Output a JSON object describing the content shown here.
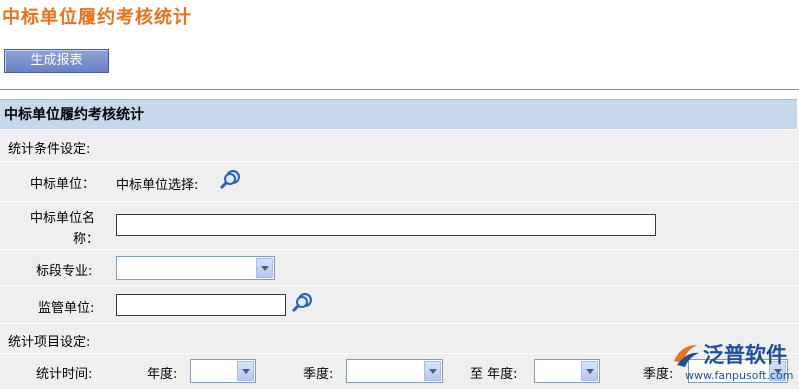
{
  "page": {
    "title": "中标单位履约考核统计"
  },
  "toolbar": {
    "generate_label": "生成报表"
  },
  "panel": {
    "header": "中标单位履约考核统计"
  },
  "conditions": {
    "section_label": "统计条件设定:",
    "winning_unit_label": "中标单位：",
    "winning_unit_select_text": "中标单位选择:",
    "winning_unit_name_label_line1": "中标单位名",
    "winning_unit_name_label_line2": "称：",
    "winning_unit_name_value": "",
    "section_specialty_label": "标段专业:",
    "section_specialty_value": "",
    "supervisor_label": "监管单位:",
    "supervisor_value": ""
  },
  "items": {
    "section_label": "统计项目设定:",
    "time_label": "统计时间:",
    "year_label": "年度:",
    "year_value": "",
    "quarter_label": "季度:",
    "quarter_value": "",
    "to_year_label": "至 年度:",
    "to_year_value": "",
    "to_quarter_label": "季度:",
    "to_quarter_value": ""
  },
  "watermark": {
    "name": "泛普软件",
    "url": "www.fanpusoft.com"
  },
  "colors": {
    "title": "#e8731a",
    "header_bg": "#c6d8ec",
    "row_bg": "#efefef",
    "button": "#7b8fcc",
    "rule": "#6fae46"
  }
}
